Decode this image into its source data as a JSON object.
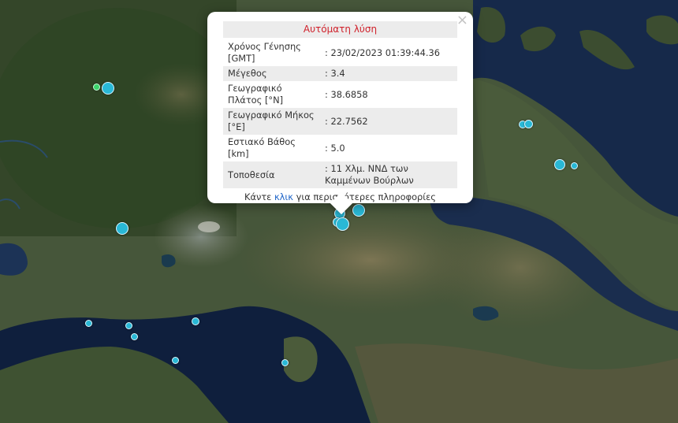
{
  "popup": {
    "title": "Αυτόματη λύση",
    "close_symbol": "×",
    "rows": [
      {
        "label": "Χρόνος Γένησης [GMT]",
        "value": ": 23/02/2023 01:39:44.36"
      },
      {
        "label": "Μέγεθος",
        "value": ": 3.4"
      },
      {
        "label": "Γεωγραφικό Πλάτος [°N]",
        "value": ": 38.6858"
      },
      {
        "label": "Γεωγραφικό Μήκος [°E]",
        "value": ": 22.7562"
      },
      {
        "label": "Εστιακό Βάθος [km]",
        "value": ": 5.0"
      },
      {
        "label": "Τοποθεσία",
        "value": ": 11 Χλμ. ΝΝΔ των Καμμένων Βούρλων"
      }
    ],
    "more_prefix": "Κάντε ",
    "more_link": "κλικ",
    "more_suffix": " για περισσότερες πληροφορίες"
  },
  "colors": {
    "marker": "#29b8d6",
    "marker_recent": "#3bd36a",
    "popup_title": "#d0212b",
    "link": "#1e64c8"
  }
}
